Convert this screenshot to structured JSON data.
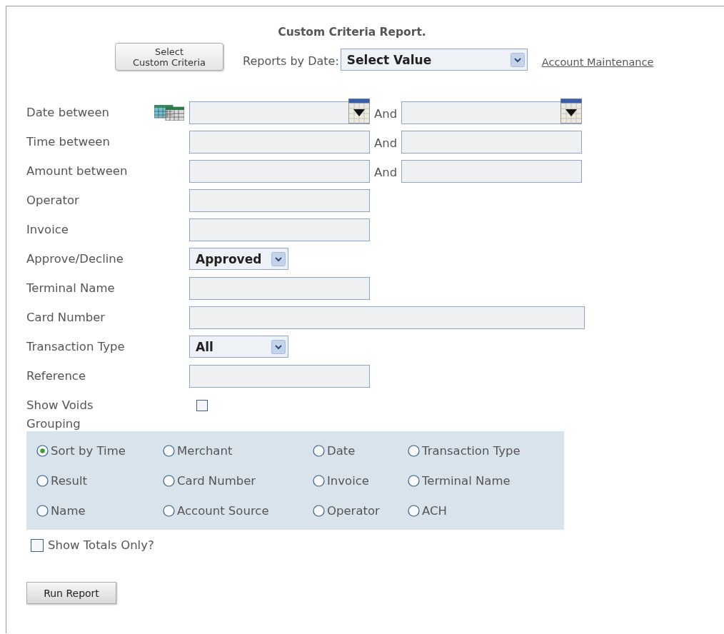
{
  "title": "Custom Criteria Report.",
  "custom_button": {
    "lines": [
      "Select",
      "Custom Criteria"
    ]
  },
  "reports_by_date": {
    "label": "Reports by Date:",
    "value": "Select Value"
  },
  "account_link": "Account Maintenance",
  "criteria": [
    {
      "kind": "date_range",
      "label": "Date between",
      "joiner": "And"
    },
    {
      "kind": "range",
      "label": "Time between",
      "joiner": "And"
    },
    {
      "kind": "range",
      "label": "Amount between",
      "joiner": "And"
    },
    {
      "kind": "text",
      "label": "Operator"
    },
    {
      "kind": "text",
      "label": "Invoice"
    },
    {
      "kind": "select",
      "label": "Approve/Decline",
      "value": "Approved"
    },
    {
      "kind": "text",
      "label": "Terminal Name"
    },
    {
      "kind": "wide_text",
      "label": "Card Number"
    },
    {
      "kind": "select",
      "label": "Transaction Type",
      "value": "All"
    },
    {
      "kind": "text",
      "label": "Reference"
    },
    {
      "kind": "checkbox",
      "label": "Show Voids",
      "checked": false
    }
  ],
  "grouping": {
    "label": "Grouping",
    "options": [
      {
        "label": "Sort by Time",
        "selected": true
      },
      {
        "label": "Merchant",
        "selected": false
      },
      {
        "label": "Date",
        "selected": false
      },
      {
        "label": "Transaction Type",
        "selected": false
      },
      {
        "label": "Result",
        "selected": false
      },
      {
        "label": "Card Number",
        "selected": false
      },
      {
        "label": "Invoice",
        "selected": false
      },
      {
        "label": "Terminal Name",
        "selected": false
      },
      {
        "label": "Name",
        "selected": false
      },
      {
        "label": "Account Source",
        "selected": false
      },
      {
        "label": "Operator",
        "selected": false
      },
      {
        "label": "ACH",
        "selected": false
      }
    ]
  },
  "show_totals": {
    "label": "Show Totals Only?",
    "checked": false
  },
  "run_button": "Run Report"
}
